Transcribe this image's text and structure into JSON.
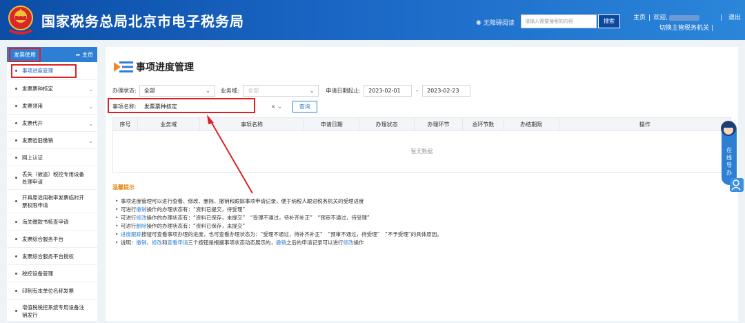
{
  "header": {
    "site_title": "国家税务总局北京市电子税务局",
    "accessibility": "无障碍阅读",
    "search_placeholder": "请输入需要搜索的内容",
    "search_button": "搜索",
    "home": "主页",
    "welcome": "欢迎,",
    "switch_org": "切换主管税务机关",
    "logout": "退出"
  },
  "sidebar": {
    "header_label": "发票使用",
    "home_link": "主页",
    "items": [
      {
        "label": "事项进度管理",
        "has_children": false
      },
      {
        "label": "发票票种核定",
        "has_children": true
      },
      {
        "label": "发票领用",
        "has_children": true
      },
      {
        "label": "发票代开",
        "has_children": true
      },
      {
        "label": "发票验旧缴销",
        "has_children": true
      },
      {
        "label": "网上认证",
        "has_children": false
      },
      {
        "label": "丢失（被盗）税控专用设备处理申请",
        "has_children": false
      },
      {
        "label": "开具原适用税率发票临时开票权限申请",
        "has_children": false
      },
      {
        "label": "海关缴款书核查申请",
        "has_children": false
      },
      {
        "label": "发票综合服务平台",
        "has_children": false
      },
      {
        "label": "发票综合服务平台授权",
        "has_children": false
      },
      {
        "label": "税控设备管理",
        "has_children": false
      },
      {
        "label": "印制有本单位名称发票",
        "has_children": false
      },
      {
        "label": "增值税税控系统专用设备注销发行",
        "has_children": false
      }
    ]
  },
  "main": {
    "title": "事项进度管理",
    "filters": {
      "status_label": "办理状态:",
      "status_value": "全部",
      "domain_label": "业务域:",
      "domain_value": "全部",
      "date_label": "申请日期起止:",
      "date_from": "2023-02-01",
      "date_sep": "-",
      "date_to": "2023-02-23",
      "name_label": "事项名称:",
      "name_value": "发票票种核定",
      "clear": "×",
      "query_button": "查询"
    },
    "table": {
      "columns": [
        "序号",
        "业务域",
        "事项名称",
        "申请日期",
        "办理状态",
        "办理环节",
        "总环节数",
        "办结期限",
        "操作"
      ],
      "empty_text": "暂无数据"
    },
    "tips_title": "温馨提示",
    "tips": [
      [
        {
          "t": "事项进度管理可以进行查看、修改、删除、撤销和跟踪事项申请记录，便于纳税人跟进税务机关的受理进度"
        }
      ],
      [
        {
          "t": "可进行"
        },
        {
          "t": "撤销",
          "hl": true
        },
        {
          "t": "操作的办理状态有：“资料已提交，待受理”"
        }
      ],
      [
        {
          "t": "可进行"
        },
        {
          "t": "修改",
          "hl": true
        },
        {
          "t": "操作的办理状态有：“资料已保存，未提交”　“受理不通过，待补齐补正”　“预审不通过，待受理”"
        }
      ],
      [
        {
          "t": "可进行"
        },
        {
          "t": "删除",
          "hl": true
        },
        {
          "t": "操作的办理状态有：“资料已保存，未提交”"
        }
      ],
      [
        {
          "t": "进度跟踪",
          "hl": true
        },
        {
          "t": "按钮可查看事项办理的进度，也可查看办理状态为：“受理不通过，待补齐补正”　“预审不通过，待受理”　“不予受理”的具体原因。"
        }
      ],
      [
        {
          "t": "说明："
        },
        {
          "t": "撤销",
          "hl": true
        },
        {
          "t": "、"
        },
        {
          "t": "修改",
          "hl": true
        },
        {
          "t": "和"
        },
        {
          "t": "查看申请",
          "hl": true
        },
        {
          "t": "三个按钮是根据事项状态动态展示的，"
        },
        {
          "t": "撤销",
          "hl": true
        },
        {
          "t": "之后的申请记录可以进行"
        },
        {
          "t": "修改",
          "hl": true
        },
        {
          "t": "操作"
        }
      ]
    ]
  },
  "guide": {
    "text": "在线导办"
  },
  "colors": {
    "brand": "#1a66c4",
    "highlight": "#e02020",
    "tips": "#e28a18"
  }
}
